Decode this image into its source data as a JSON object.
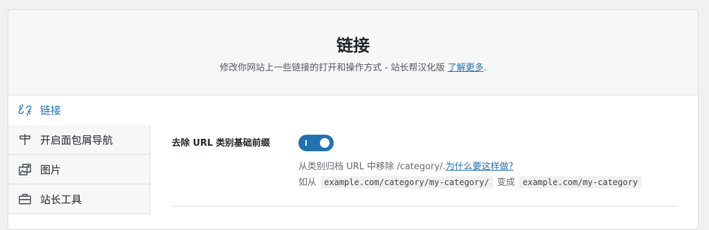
{
  "header": {
    "title": "链接",
    "subtitle": "修改你网站上一些链接的打开和操作方式 - 站长帮汉化版",
    "learn_more": "了解更多",
    "period": "."
  },
  "sidebar": {
    "items": [
      {
        "label": "链接",
        "icon": "link-icon",
        "active": true
      },
      {
        "label": "开启面包屑导航",
        "icon": "signpost-icon",
        "active": false
      },
      {
        "label": "图片",
        "icon": "images-icon",
        "active": false
      },
      {
        "label": "站长工具",
        "icon": "toolbox-icon",
        "active": false
      }
    ]
  },
  "setting": {
    "label": "去除 URL 类别基础前缀",
    "enabled": true,
    "desc_line1": "从类别归档 URL 中移除 /category/.",
    "why_link": "为什么要这样做?",
    "desc_line2_prefix": "如从",
    "code_from": "example.com/category/my-category/",
    "desc_line2_mid": "变成",
    "code_to": "example.com/my-category"
  },
  "colors": {
    "accent": "#2271b1",
    "border": "#dcdcde"
  }
}
